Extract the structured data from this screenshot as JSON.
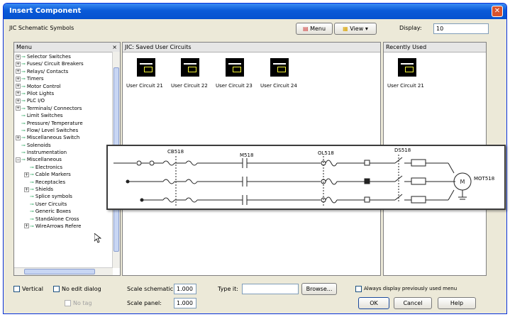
{
  "window": {
    "title": "Insert Component"
  },
  "toolbar": {
    "library_name": "JIC Schematic Symbols",
    "menu_label": "Menu",
    "view_label": "View",
    "display_label": "Display:",
    "display_value": "10"
  },
  "menu_panel": {
    "title": "Menu",
    "items": [
      {
        "label": "Selector Switches",
        "expandable": true
      },
      {
        "label": "Fuses/ Circuit Breakers",
        "expandable": true
      },
      {
        "label": "Relays/ Contacts",
        "expandable": true
      },
      {
        "label": "Timers",
        "expandable": true
      },
      {
        "label": "Motor Control",
        "expandable": true
      },
      {
        "label": "Pilot Lights",
        "expandable": true
      },
      {
        "label": "PLC I/O",
        "expandable": true
      },
      {
        "label": "Terminals/ Connectors",
        "expandable": true
      },
      {
        "label": "Limit Switches",
        "expandable": false
      },
      {
        "label": "Pressure/ Temperature",
        "expandable": false
      },
      {
        "label": "Flow/ Level Switches",
        "expandable": false
      },
      {
        "label": "Miscellaneous Switch",
        "expandable": true
      },
      {
        "label": "Solenoids",
        "expandable": false
      },
      {
        "label": "Instrumentation",
        "expandable": false
      },
      {
        "label": "Miscellaneous",
        "expandable": true
      },
      {
        "label": "Electronics",
        "expandable": false
      },
      {
        "label": "Cable Markers",
        "expandable": true
      },
      {
        "label": "Receptacles",
        "expandable": false
      },
      {
        "label": "Shields",
        "expandable": true
      },
      {
        "label": "Splice symbols",
        "expandable": false
      },
      {
        "label": "User Circuits",
        "expandable": false
      },
      {
        "label": "Generic Boxes",
        "expandable": false
      },
      {
        "label": "StandAlone Cross",
        "expandable": false
      },
      {
        "label": "WireArrows Refere",
        "expandable": true
      }
    ]
  },
  "saved_circuits": {
    "title": "JIC: Saved User Circuits",
    "items": [
      "User Circuit 21",
      "User Circuit 22",
      "User Circuit 23",
      "User Circuit 24"
    ]
  },
  "recent": {
    "title": "Recently Used",
    "items": [
      "User Circuit 21"
    ]
  },
  "preview": {
    "labels": {
      "cb": "CB518",
      "m": "M518",
      "ol": "OL518",
      "ds": "DS518",
      "mot": "MOT518"
    }
  },
  "bottom": {
    "vertical_label": "Vertical",
    "no_edit_label": "No edit dialog",
    "no_tag_label": "No tag",
    "scale_schematic_label": "Scale schematic:",
    "scale_schematic_value": "1.000",
    "scale_panel_label": "Scale panel:",
    "scale_panel_value": "1.000",
    "type_it_label": "Type it:",
    "type_it_value": "",
    "browse_label": "Browse...",
    "always_label": "Always display previously used menu",
    "ok_label": "OK",
    "cancel_label": "Cancel",
    "help_label": "Help"
  },
  "colors": {
    "titlebar": "#0a5ad8",
    "accent": "#316ac5"
  }
}
